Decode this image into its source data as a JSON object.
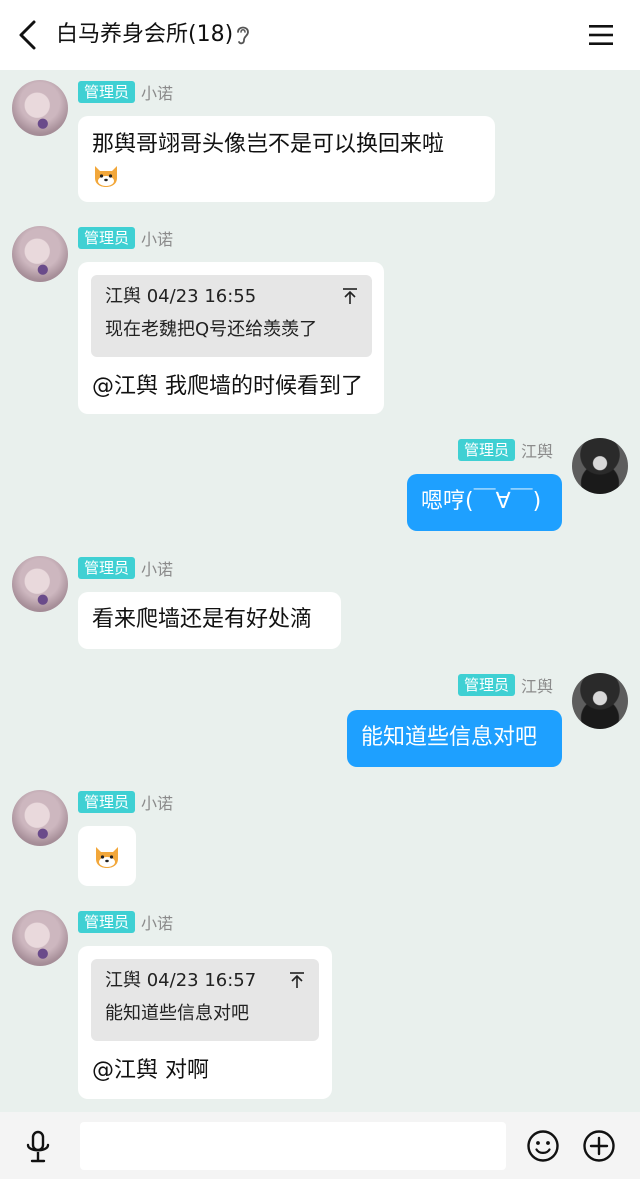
{
  "header": {
    "title": "白马养身会所(18)",
    "icons": [
      "back-arrow-icon",
      "ear-icon",
      "menu-icon"
    ]
  },
  "messages": [
    {
      "sender": "小诺",
      "badge": "管理员",
      "side": "left",
      "text": "那舆哥翊哥头像岂不是可以换回来啦",
      "emoji": "shiba-dog-emoji"
    },
    {
      "sender": "小诺",
      "badge": "管理员",
      "side": "left",
      "quote": {
        "author_time": "江舆 04/23 16:55",
        "text": "现在老魏把Q号还给羡羡了"
      },
      "text": "@江舆 我爬墙的时候看到了"
    },
    {
      "sender": "江舆",
      "badge": "管理员",
      "side": "right",
      "text": "嗯哼(￣∀￣)"
    },
    {
      "sender": "小诺",
      "badge": "管理员",
      "side": "left",
      "text": "看来爬墙还是有好处滴"
    },
    {
      "sender": "江舆",
      "badge": "管理员",
      "side": "right",
      "text": "能知道些信息对吧"
    },
    {
      "sender": "小诺",
      "badge": "管理员",
      "side": "left",
      "emoji": "shiba-dog-emoji"
    },
    {
      "sender": "小诺",
      "badge": "管理员",
      "side": "left",
      "quote": {
        "author_time": "江舆 04/23 16:57",
        "text": "能知道些信息对吧"
      },
      "text": "@江舆 对啊"
    }
  ],
  "composer": {
    "placeholder": "",
    "icons": [
      "microphone-icon",
      "emoji-icon",
      "plus-icon"
    ]
  },
  "colors": {
    "background": "#e9f0ed",
    "badge": "#3fd0d3",
    "own_bubble": "#1ea0ff",
    "other_bubble": "#ffffff"
  }
}
